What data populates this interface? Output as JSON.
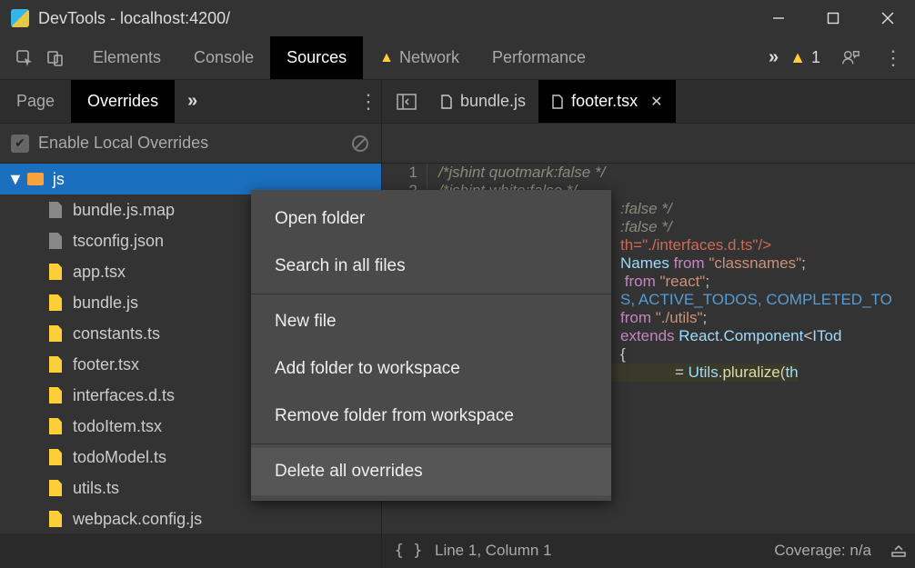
{
  "title": "DevTools - localhost:4200/",
  "toptabs": [
    "Elements",
    "Console",
    "Sources",
    "Network",
    "Performance"
  ],
  "toptab_active": "Sources",
  "toptab_warn_index": 3,
  "warning_count": "1",
  "subtabs": [
    "Page",
    "Overrides"
  ],
  "subtab_active": "Overrides",
  "openfiles": [
    {
      "name": "bundle.js",
      "active": false,
      "close": false
    },
    {
      "name": "footer.tsx",
      "active": true,
      "close": true
    }
  ],
  "enable_overrides_label": "Enable Local Overrides",
  "tree": {
    "folder": "js",
    "files": [
      {
        "name": "bundle.js.map",
        "mod": false
      },
      {
        "name": "tsconfig.json",
        "mod": false
      },
      {
        "name": "app.tsx",
        "mod": true
      },
      {
        "name": "bundle.js",
        "mod": true
      },
      {
        "name": "constants.ts",
        "mod": true
      },
      {
        "name": "footer.tsx",
        "mod": true
      },
      {
        "name": "interfaces.d.ts",
        "mod": true
      },
      {
        "name": "todoItem.tsx",
        "mod": true
      },
      {
        "name": "todoModel.ts",
        "mod": true
      },
      {
        "name": "utils.ts",
        "mod": true
      },
      {
        "name": "webpack.config.js",
        "mod": true
      }
    ]
  },
  "context_menu": [
    "Open folder",
    "Search in all files",
    "New file",
    "Add folder to workspace",
    "Remove folder from workspace",
    "Delete all overrides"
  ],
  "context_hover": "Delete all overrides",
  "context_separators_after": [
    1,
    4
  ],
  "code_start_lines": [
    "1",
    "2"
  ],
  "code_comments": [
    "/*jshint quotmark:false */",
    "/*jshint white:false */",
    ":false */",
    ":false */"
  ],
  "code_tag_tail": "th=\"./interfaces.d.ts\"/>",
  "code_imports": [
    {
      "id": "Names",
      "from": "\"classnames\""
    },
    {
      "id": "",
      "from": "\"react\""
    }
  ],
  "code_consts": "S, ACTIVE_TODOS, COMPLETED_TO",
  "code_from_utils": "from \"./utils\";",
  "code_class": "extends React.Component<ITod",
  "code_brace": "{",
  "code_utils_call": "= Utils.pluralize(th",
  "status_pos": "Line 1, Column 1",
  "status_cov": "Coverage: n/a"
}
